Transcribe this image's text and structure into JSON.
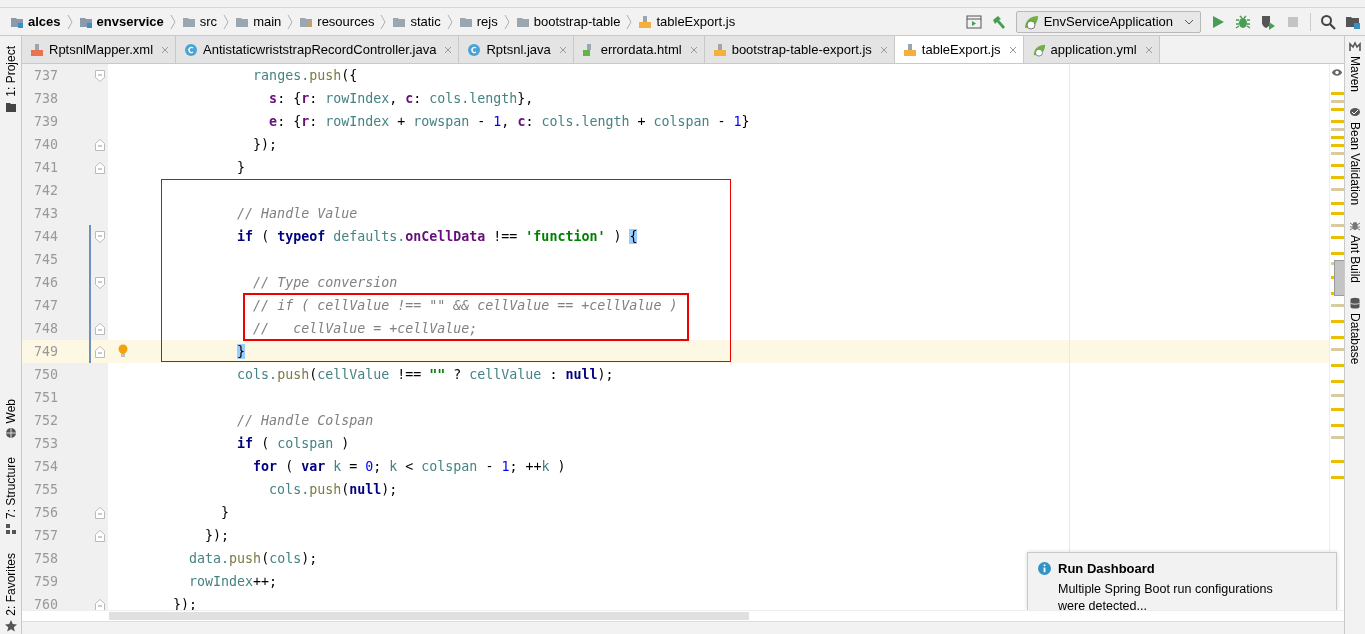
{
  "breadcrumb": [
    {
      "label": "alces",
      "kind": "module",
      "bold": true
    },
    {
      "label": "envservice",
      "kind": "module",
      "bold": true
    },
    {
      "label": "src",
      "kind": "folder",
      "bold": false
    },
    {
      "label": "main",
      "kind": "folder",
      "bold": false
    },
    {
      "label": "resources",
      "kind": "resources",
      "bold": false
    },
    {
      "label": "static",
      "kind": "folder",
      "bold": false
    },
    {
      "label": "rejs",
      "kind": "folder",
      "bold": false
    },
    {
      "label": "bootstrap-table",
      "kind": "folder",
      "bold": false
    },
    {
      "label": "tableExport.js",
      "kind": "js",
      "bold": false
    }
  ],
  "run_config": {
    "label": "EnvServiceApplication"
  },
  "tabs": [
    {
      "label": "RptsnlMapper.xml",
      "kind": "xml",
      "selected": false
    },
    {
      "label": "AntistaticwriststrapRecordController.java",
      "kind": "class",
      "selected": false
    },
    {
      "label": "Rptsnl.java",
      "kind": "class",
      "selected": false
    },
    {
      "label": "errordata.html",
      "kind": "html",
      "selected": false
    },
    {
      "label": "bootstrap-table-export.js",
      "kind": "js",
      "selected": false
    },
    {
      "label": "tableExport.js",
      "kind": "js",
      "selected": true
    },
    {
      "label": "application.yml",
      "kind": "spring",
      "selected": false
    }
  ],
  "left_tools": [
    {
      "label": "1: Project",
      "kind": "folder"
    },
    {
      "label": "Web",
      "kind": "globe"
    },
    {
      "label": "7: Structure",
      "kind": "structure"
    },
    {
      "label": "2: Favorites",
      "kind": "star"
    }
  ],
  "right_tools": [
    {
      "label": "Maven",
      "kind": "maven"
    },
    {
      "label": "Bean Validation",
      "kind": "bean"
    },
    {
      "label": "Ant Build",
      "kind": "ant"
    },
    {
      "label": "Database",
      "kind": "database"
    }
  ],
  "lines": [
    {
      "number": "737",
      "kind": "fold_start",
      "changed": false,
      "current": false,
      "tokens": [
        {
          "kind": "ident",
          "text": "                  ranges."
        },
        {
          "kind": "func",
          "text": "push"
        },
        {
          "kind": "plain",
          "text": "({"
        }
      ]
    },
    {
      "number": "738",
      "kind": "plain",
      "changed": false,
      "current": false,
      "tokens": [
        {
          "kind": "prop",
          "text": "                    s"
        },
        {
          "kind": "plain",
          "text": ": {"
        },
        {
          "kind": "prop",
          "text": "r"
        },
        {
          "kind": "plain",
          "text": ": "
        },
        {
          "kind": "ident",
          "text": "rowIndex"
        },
        {
          "kind": "plain",
          "text": ", "
        },
        {
          "kind": "prop",
          "text": "c"
        },
        {
          "kind": "plain",
          "text": ": "
        },
        {
          "kind": "ident",
          "text": "cols.length"
        },
        {
          "kind": "plain",
          "text": "},"
        }
      ]
    },
    {
      "number": "739",
      "kind": "plain",
      "changed": false,
      "current": false,
      "tokens": [
        {
          "kind": "prop",
          "text": "                    e"
        },
        {
          "kind": "plain",
          "text": ": {"
        },
        {
          "kind": "prop",
          "text": "r"
        },
        {
          "kind": "plain",
          "text": ": "
        },
        {
          "kind": "ident",
          "text": "rowIndex"
        },
        {
          "kind": "plain",
          "text": " + "
        },
        {
          "kind": "ident",
          "text": "rowspan"
        },
        {
          "kind": "plain",
          "text": " - "
        },
        {
          "kind": "number",
          "text": "1"
        },
        {
          "kind": "plain",
          "text": ", "
        },
        {
          "kind": "prop",
          "text": "c"
        },
        {
          "kind": "plain",
          "text": ": "
        },
        {
          "kind": "ident",
          "text": "cols.length"
        },
        {
          "kind": "plain",
          "text": " + "
        },
        {
          "kind": "ident",
          "text": "colspan"
        },
        {
          "kind": "plain",
          "text": " - "
        },
        {
          "kind": "number",
          "text": "1"
        },
        {
          "kind": "plain",
          "text": "}"
        }
      ]
    },
    {
      "number": "740",
      "kind": "fold_end",
      "changed": false,
      "current": false,
      "tokens": [
        {
          "kind": "plain",
          "text": "                  });"
        }
      ]
    },
    {
      "number": "741",
      "kind": "fold_end",
      "changed": false,
      "current": false,
      "tokens": [
        {
          "kind": "plain",
          "text": "                }"
        }
      ]
    },
    {
      "number": "742",
      "kind": "plain",
      "changed": false,
      "current": false
    },
    {
      "number": "743",
      "kind": "plain",
      "changed": false,
      "current": false,
      "tokens": [
        {
          "kind": "comment",
          "text": "                // Handle Value"
        }
      ]
    },
    {
      "number": "744",
      "kind": "fold_start",
      "changed": true,
      "current": false,
      "tokens": [
        {
          "kind": "keyword",
          "text": "                if"
        },
        {
          "kind": "plain",
          "text": " ( "
        },
        {
          "kind": "keyword",
          "text": "typeof "
        },
        {
          "kind": "ident",
          "text": "defaults."
        },
        {
          "kind": "prop",
          "text": "onCellData"
        },
        {
          "kind": "plain",
          "text": " !== "
        },
        {
          "kind": "string",
          "text": "'function'"
        },
        {
          "kind": "plain",
          "text": " ) "
        },
        {
          "kind": "match",
          "text": "{"
        }
      ]
    },
    {
      "number": "745",
      "kind": "plain",
      "changed": true,
      "current": false
    },
    {
      "number": "746",
      "kind": "fold_start",
      "changed": true,
      "current": false,
      "tokens": [
        {
          "kind": "comment",
          "text": "                  // Type conversion"
        }
      ]
    },
    {
      "number": "747",
      "kind": "plain",
      "changed": true,
      "current": false,
      "tokens": [
        {
          "kind": "comment",
          "text": "                  // if ( cellValue !== \"\" && cellValue == +cellValue )"
        }
      ]
    },
    {
      "number": "748",
      "kind": "fold_end",
      "changed": true,
      "current": false,
      "tokens": [
        {
          "kind": "comment",
          "text": "                  //   cellValue = +cellValue;"
        }
      ]
    },
    {
      "number": "749",
      "kind": "fold_end",
      "changed": true,
      "current": true,
      "tokens": [
        {
          "kind": "match",
          "text": "                }"
        }
      ]
    },
    {
      "number": "750",
      "kind": "plain",
      "changed": false,
      "current": false,
      "tokens": [
        {
          "kind": "ident",
          "text": "                cols."
        },
        {
          "kind": "func",
          "text": "push"
        },
        {
          "kind": "plain",
          "text": "("
        },
        {
          "kind": "ident",
          "text": "cellValue"
        },
        {
          "kind": "plain",
          "text": " !== "
        },
        {
          "kind": "string",
          "text": "\"\""
        },
        {
          "kind": "plain",
          "text": " ? "
        },
        {
          "kind": "ident",
          "text": "cellValue"
        },
        {
          "kind": "plain",
          "text": " : "
        },
        {
          "kind": "keyword",
          "text": "null"
        },
        {
          "kind": "plain",
          "text": ");"
        }
      ]
    },
    {
      "number": "751",
      "kind": "plain",
      "changed": false,
      "current": false
    },
    {
      "number": "752",
      "kind": "plain",
      "changed": false,
      "current": false,
      "tokens": [
        {
          "kind": "comment",
          "text": "                // Handle Colspan"
        }
      ]
    },
    {
      "number": "753",
      "kind": "plain",
      "changed": false,
      "current": false,
      "tokens": [
        {
          "kind": "keyword",
          "text": "                if"
        },
        {
          "kind": "plain",
          "text": " ( "
        },
        {
          "kind": "ident",
          "text": "colspan"
        },
        {
          "kind": "plain",
          "text": " )"
        }
      ]
    },
    {
      "number": "754",
      "kind": "plain",
      "changed": false,
      "current": false,
      "tokens": [
        {
          "kind": "keyword",
          "text": "                  for"
        },
        {
          "kind": "plain",
          "text": " ( "
        },
        {
          "kind": "keyword",
          "text": "var "
        },
        {
          "kind": "ident",
          "text": "k"
        },
        {
          "kind": "plain",
          "text": " = "
        },
        {
          "kind": "number",
          "text": "0"
        },
        {
          "kind": "plain",
          "text": "; "
        },
        {
          "kind": "ident",
          "text": "k"
        },
        {
          "kind": "plain",
          "text": " < "
        },
        {
          "kind": "ident",
          "text": "colspan"
        },
        {
          "kind": "plain",
          "text": " - "
        },
        {
          "kind": "number",
          "text": "1"
        },
        {
          "kind": "plain",
          "text": "; ++"
        },
        {
          "kind": "ident",
          "text": "k"
        },
        {
          "kind": "plain",
          "text": " )"
        }
      ]
    },
    {
      "number": "755",
      "kind": "plain",
      "changed": false,
      "current": false,
      "tokens": [
        {
          "kind": "ident",
          "text": "                    cols."
        },
        {
          "kind": "func",
          "text": "push"
        },
        {
          "kind": "plain",
          "text": "("
        },
        {
          "kind": "keyword",
          "text": "null"
        },
        {
          "kind": "plain",
          "text": ");"
        }
      ]
    },
    {
      "number": "756",
      "kind": "fold_end",
      "changed": false,
      "current": false,
      "tokens": [
        {
          "kind": "plain",
          "text": "              }"
        }
      ]
    },
    {
      "number": "757",
      "kind": "fold_end",
      "changed": false,
      "current": false,
      "tokens": [
        {
          "kind": "plain",
          "text": "            });"
        }
      ]
    },
    {
      "number": "758",
      "kind": "plain",
      "changed": false,
      "current": false,
      "tokens": [
        {
          "kind": "ident",
          "text": "          data."
        },
        {
          "kind": "func",
          "text": "push"
        },
        {
          "kind": "plain",
          "text": "("
        },
        {
          "kind": "ident",
          "text": "cols"
        },
        {
          "kind": "plain",
          "text": ");"
        }
      ]
    },
    {
      "number": "759",
      "kind": "plain",
      "changed": false,
      "current": false,
      "tokens": [
        {
          "kind": "ident",
          "text": "          rowIndex"
        },
        {
          "kind": "plain",
          "text": "++;"
        }
      ]
    },
    {
      "number": "760",
      "kind": "fold_end",
      "changed": false,
      "current": false,
      "tokens": [
        {
          "kind": "plain",
          "text": "        });"
        }
      ]
    }
  ],
  "notification": {
    "title": "Run Dashboard",
    "message": "Multiple Spring Boot run configurations were detected..."
  }
}
